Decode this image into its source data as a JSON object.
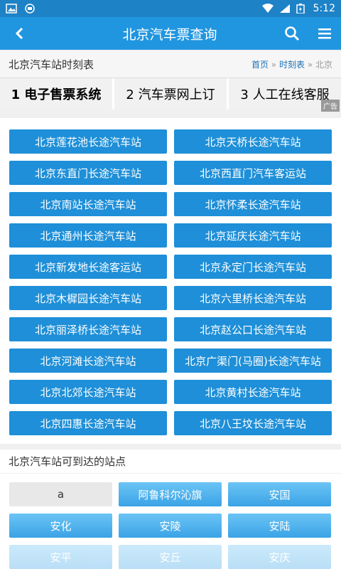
{
  "status": {
    "time": "5:12"
  },
  "appbar": {
    "title": "北京汽车票查询"
  },
  "page": {
    "title": "北京汽车站时刻表",
    "breadcrumb": {
      "home": "首页",
      "sep1": "»",
      "middle": "时刻表",
      "sep2": "»",
      "current": "北京"
    }
  },
  "ads": {
    "items": [
      "1 电子售票系统",
      "2 汽车票网上订",
      "3 人工在线客服"
    ],
    "tag": "广告"
  },
  "stations": [
    "北京莲花池长途汽车站",
    "北京天桥长途汽车站",
    "北京东直门长途汽车站",
    "北京西直门汽车客运站",
    "北京南站长途汽车站",
    "北京怀柔长途汽车站",
    "北京通州长途汽车站",
    "北京延庆长途汽车站",
    "北京新发地长途客运站",
    "北京永定门长途汽车站",
    "北京木樨园长途汽车站",
    "北京六里桥长途汽车站",
    "北京丽泽桥长途汽车站",
    "北京赵公口长途汽车站",
    "北京河滩长途汽车站",
    "北京广渠门(马圈)长途汽车站",
    "北京北郊长途汽车站",
    "北京黄村长途汽车站",
    "北京四惠长途汽车站",
    "北京八王坟长途汽车站"
  ],
  "destinations": {
    "header": "北京汽车站可到达的站点",
    "items": [
      "a",
      "阿鲁科尔沁旗",
      "安国",
      "安化",
      "安陵",
      "安陆",
      "安平",
      "安丘",
      "安庆"
    ]
  }
}
